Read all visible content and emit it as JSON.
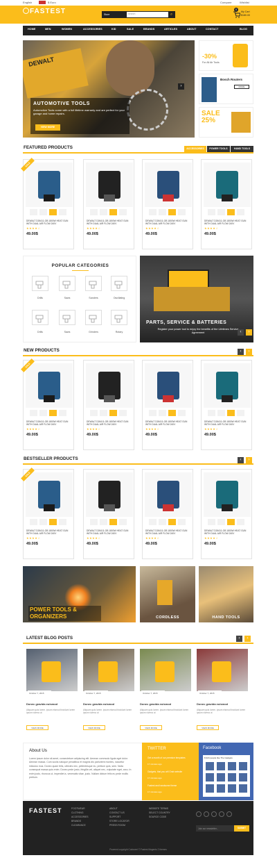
{
  "topbar": {
    "language": "English",
    "currency": "$ Euro",
    "compare": "Compare",
    "wishlist": "Wishlist"
  },
  "header": {
    "logo": "FASTEST",
    "search_category": "Store",
    "search_placeholder": "search",
    "cart_label": "My Cart",
    "cart_total": "$180.00",
    "cart_count": "0"
  },
  "nav": [
    "HOME",
    "MEN",
    "WOMEN",
    "ACCESSORIES",
    "KID",
    "SALE",
    "BRANDS",
    "ARTICLES",
    "ABOUT",
    "CONTACT",
    "BLOG"
  ],
  "hero": {
    "title": "AUTOMOTIVE TOOLS",
    "text": "Automotive Tools come with a full lifetime warranty and are perfect for your garage and home repairs.",
    "button": "VIEW MORE",
    "brand": "DEWALT"
  },
  "side_banners": [
    {
      "big": "-30%",
      "small": "For All Air Tools"
    },
    {
      "big": "Bosch Routers",
      "small": "MORE"
    },
    {
      "big": "SALE 25%",
      "small": ""
    }
  ],
  "featured": {
    "title": "FEATURED PRODUCTS",
    "tabs": [
      "ACCESSORIES",
      "POWER TOOLS",
      "HAND TOOLS"
    ]
  },
  "product_name": "DEWALT D26411-GB 1800W HEAT GUN WITH DUAL AIR FLOW 240V",
  "product_price": "49.00$",
  "sale_badge": "SALE",
  "categories": {
    "title": "POPULAR CATEGORIES",
    "items": [
      "Drills",
      "Saws",
      "Sanders",
      "Oscillating",
      "Drills",
      "Saws",
      "Grinders",
      "Rotary"
    ]
  },
  "parts_banner": {
    "title": "PARTS, SERVICE & BATTERIES",
    "text": "Register your power tool to enjoy the benefits of the Lifetimes Service Agreement"
  },
  "new_products": {
    "title": "NEW PRODUCTS"
  },
  "bestseller": {
    "title": "BESTSELLER PRODUCTS"
  },
  "promos": [
    {
      "label": "POWER TOOLS & ORGANIZERS"
    },
    {
      "label": "CORDLESS"
    },
    {
      "label": "HAND TOOLS"
    }
  ],
  "blog": {
    "title": "LATEST BLOG POSTS",
    "post_title": "Donec gravida euismod",
    "post_date": "October 7, 2015",
    "post_text": "Aliquam quis lorem. ipsum eismod tincidunt lorem ipsum viverra ut",
    "button": "VIEW MORE"
  },
  "about": {
    "title": "About Us",
    "text": "Lorem ipsum dolor sit amet, consectetuer adipiscing elit. Aenean commodo ligula eget dolor. Aenean massa. Cum sociis natoque penatibus et magnis dis parturient montes, nascetur ridiculus mus. Donec quam felis, ultricies nec, pellentesque eu, pretium quis, sem. Nulla consequat massa quis enim. Donec pede justo, fringilla vel, aliquet nec, vulputate eget, arcu. In enim justo, rhoncus ut, imperdiet a, venenatis vitae, justo. Nullam dictum felis eu pede mollis pretium."
  },
  "twitter": {
    "title": "TWITTER",
    "tweets": [
      "Get a month of our premium templates",
      "Gadgets, that you will Grab website",
      "Fastest and handsome theme"
    ],
    "time": "17 minutes ago"
  },
  "facebook": {
    "title": "Facebook",
    "likes": "8,324 people like The Gadgets"
  },
  "footer": {
    "logo": "FASTEST",
    "col1": [
      "FOOTWEAR",
      "CLOTHING",
      "ACCESSORIES",
      "BRANDS",
      "CLEARANCE"
    ],
    "col2": [
      "ABOUT",
      "CONTACT US",
      "SUPPORT",
      "STORE LOCATOR",
      "PRESS ROOM"
    ],
    "col3": [
      "WEBSITE TERMS",
      "SELECT COUNTRY",
      "SOURCE CODE"
    ],
    "newsletter_placeholder": "Join our newsletter...",
    "subscribe": "SUBMIT",
    "copyright": "Powered copyright Codezeel © Fastest Magento 2 themes"
  },
  "colors": {
    "accent": "#fbbd1b",
    "dark": "#222222"
  }
}
